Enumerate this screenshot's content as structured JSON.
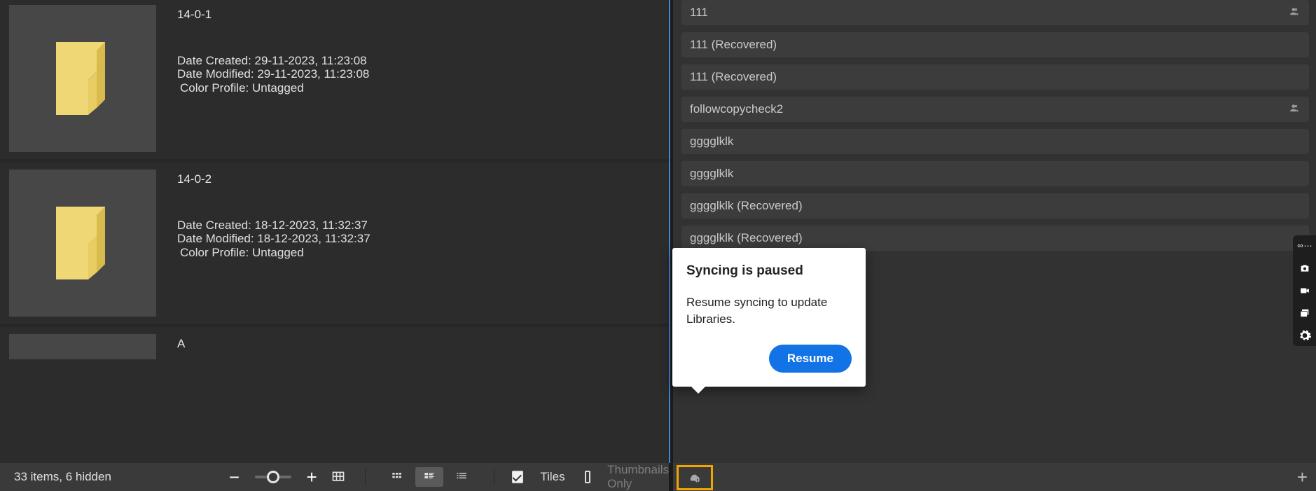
{
  "folders": [
    {
      "name": "14-0-1",
      "created": "Date Created: 29-11-2023, 11:23:08",
      "modified": "Date Modified: 29-11-2023, 11:23:08",
      "profile": "Color Profile: Untagged"
    },
    {
      "name": "14-0-2",
      "created": "Date Created: 18-12-2023, 11:32:37",
      "modified": "Date Modified: 18-12-2023, 11:32:37",
      "profile": "Color Profile: Untagged"
    }
  ],
  "peek_name": "A",
  "libraries": [
    {
      "name": "111",
      "shared": true
    },
    {
      "name": "111 (Recovered)",
      "shared": false
    },
    {
      "name": "111 (Recovered)",
      "shared": false
    },
    {
      "name": "followcopycheck2",
      "shared": true
    },
    {
      "name": "gggglklk",
      "shared": false
    },
    {
      "name": "gggglklk",
      "shared": false
    },
    {
      "name": "gggglklk (Recovered)",
      "shared": false
    },
    {
      "name": "gggglklk (Recovered)",
      "shared": false
    }
  ],
  "popup": {
    "title": "Syncing is paused",
    "body": "Resume syncing to update Libraries.",
    "button": "Resume"
  },
  "bottom": {
    "status": "33 items, 6 hidden",
    "tiles_label": "Tiles",
    "thumbs_label": "Thumbnails Only"
  }
}
